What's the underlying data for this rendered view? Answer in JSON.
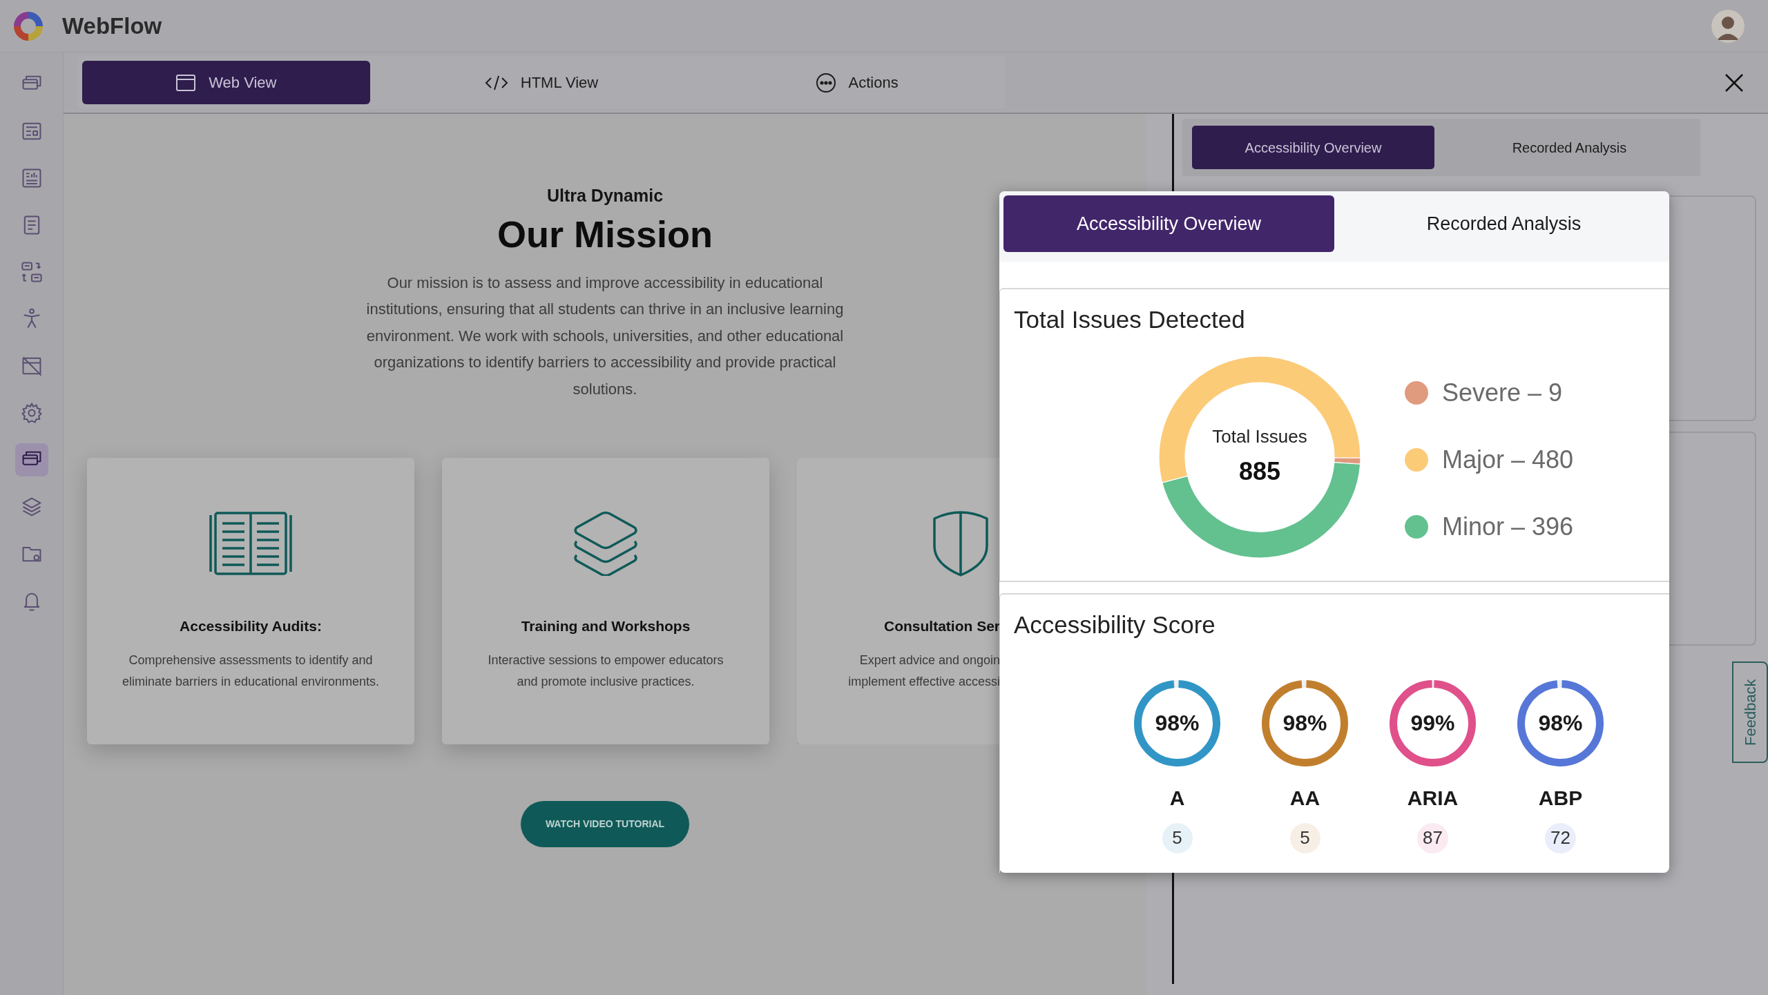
{
  "app": {
    "title": "WebFlow"
  },
  "sidebar": {
    "items": [
      {
        "selected": false
      },
      {
        "selected": false
      },
      {
        "selected": false
      },
      {
        "selected": false
      },
      {
        "selected": false
      },
      {
        "selected": false
      },
      {
        "selected": false
      },
      {
        "selected": false
      },
      {
        "selected": true
      },
      {
        "selected": false
      },
      {
        "selected": false
      },
      {
        "selected": false
      }
    ]
  },
  "view_tabs": [
    {
      "label": "Web View",
      "selected": true
    },
    {
      "label": "HTML View",
      "selected": false
    },
    {
      "label": "Actions",
      "selected": false
    }
  ],
  "page": {
    "eyebrow": "Ultra Dynamic",
    "heading": "Our Mission",
    "paragraph": "Our mission is to assess and improve accessibility in educational institutions, ensuring that all students can thrive in an inclusive learning environment. We work with schools, universities, and other educational organizations to identify barriers to accessibility and provide practical solutions.",
    "cards": [
      {
        "title": "Accessibility Audits:",
        "description_lines": [
          "Comprehensive assessments to identify and",
          "eliminate barriers in educational environments."
        ]
      },
      {
        "title": "Training and Workshops",
        "description_lines": [
          "Interactive sessions to empower educators",
          "and promote inclusive practices."
        ]
      },
      {
        "title": "Consultation Ser",
        "description_lines": [
          "Expert advice and ongoin",
          "implement effective accessi"
        ]
      }
    ],
    "button": "WATCH VIDEO TUTORIAL"
  },
  "side_panel": {
    "tabs": [
      {
        "label": "Accessibility Overview",
        "selected": true
      },
      {
        "label": "Recorded Analysis",
        "selected": false
      }
    ],
    "feedback": "Feedback"
  },
  "popup": {
    "tabs": [
      {
        "label": "Accessibility Overview",
        "selected": true
      },
      {
        "label": "Recorded Analysis",
        "selected": false
      }
    ],
    "issues": {
      "title": "Total Issues Detected",
      "center_label": "Total Issues",
      "center_value": "885",
      "chart_data": {
        "type": "donut",
        "categories": [
          "Severe – 9",
          "Major – 480",
          "Minor – 396"
        ],
        "values": [
          1.0,
          54.2,
          44.8
        ]
      },
      "legend": [
        {
          "color": "#e09a7e"
        },
        {
          "color": "#fccb78"
        },
        {
          "color": "#62c18f"
        }
      ]
    },
    "score": {
      "title": "Accessibility Score",
      "items": [
        {
          "percent": "98%",
          "level": 0.98,
          "label": "A",
          "count": "5",
          "color": "#3196c6"
        },
        {
          "percent": "98%",
          "level": 0.98,
          "label": "AA",
          "count": "5",
          "color": "#c17f2e"
        },
        {
          "percent": "99%",
          "level": 0.99,
          "label": "ARIA",
          "count": "87",
          "color": "#e0508a"
        },
        {
          "percent": "98%",
          "level": 0.98,
          "label": "ABP",
          "count": "72",
          "color": "#5677d8"
        }
      ]
    }
  }
}
